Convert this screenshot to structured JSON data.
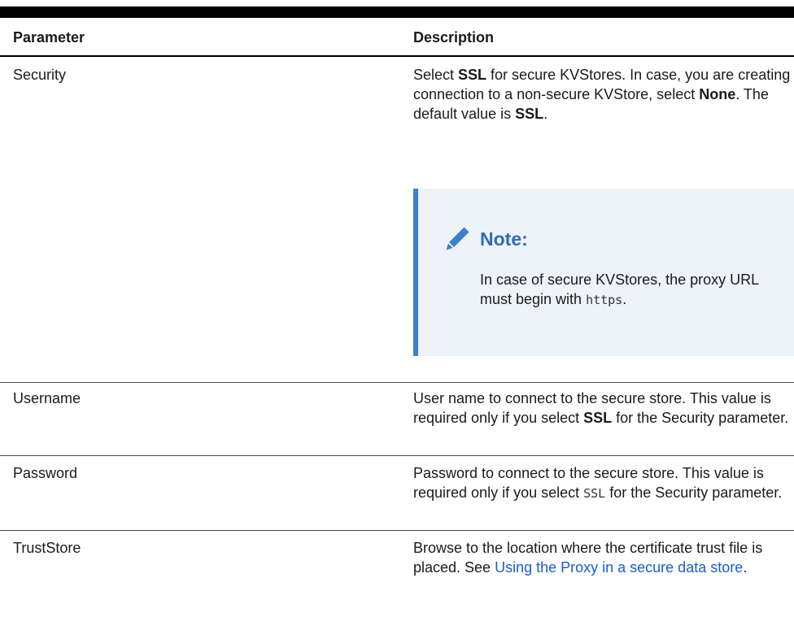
{
  "table": {
    "headers": {
      "parameter": "Parameter",
      "description": "Description"
    },
    "rows": [
      {
        "parameter": "Security",
        "description": {
          "t1": "Select ",
          "b1": "SSL",
          "t2": " for secure KVStores. In case, you are creating connection to a non-secure KVStore, select ",
          "b2": "None",
          "t3": ". The default value is ",
          "b3": "SSL",
          "t4": "."
        },
        "note": {
          "icon": "pencil-icon",
          "title": "Note:",
          "body_text": "In case of secure KVStores, the proxy URL must begin with ",
          "body_code": "https",
          "body_end": "."
        }
      },
      {
        "parameter": "Username",
        "description": {
          "t1": "User name to connect to the secure store. This value is required only if you select ",
          "b1": "SSL",
          "t2": " for the Security parameter."
        }
      },
      {
        "parameter": "Password",
        "description": {
          "t1": "Password to connect to the secure store. This value is required only if you select ",
          "code": "SSL",
          "t2": " for the Security parameter."
        }
      },
      {
        "parameter": "TrustStore",
        "description": {
          "t1": "Browse to the location where the certificate trust file is placed. See ",
          "link": "Using the Proxy in a secure data store",
          "t2": "."
        }
      }
    ]
  },
  "colors": {
    "link": "#1a5cd6",
    "note_accent": "#3f7fc7",
    "note_background": "#eef3fa"
  }
}
